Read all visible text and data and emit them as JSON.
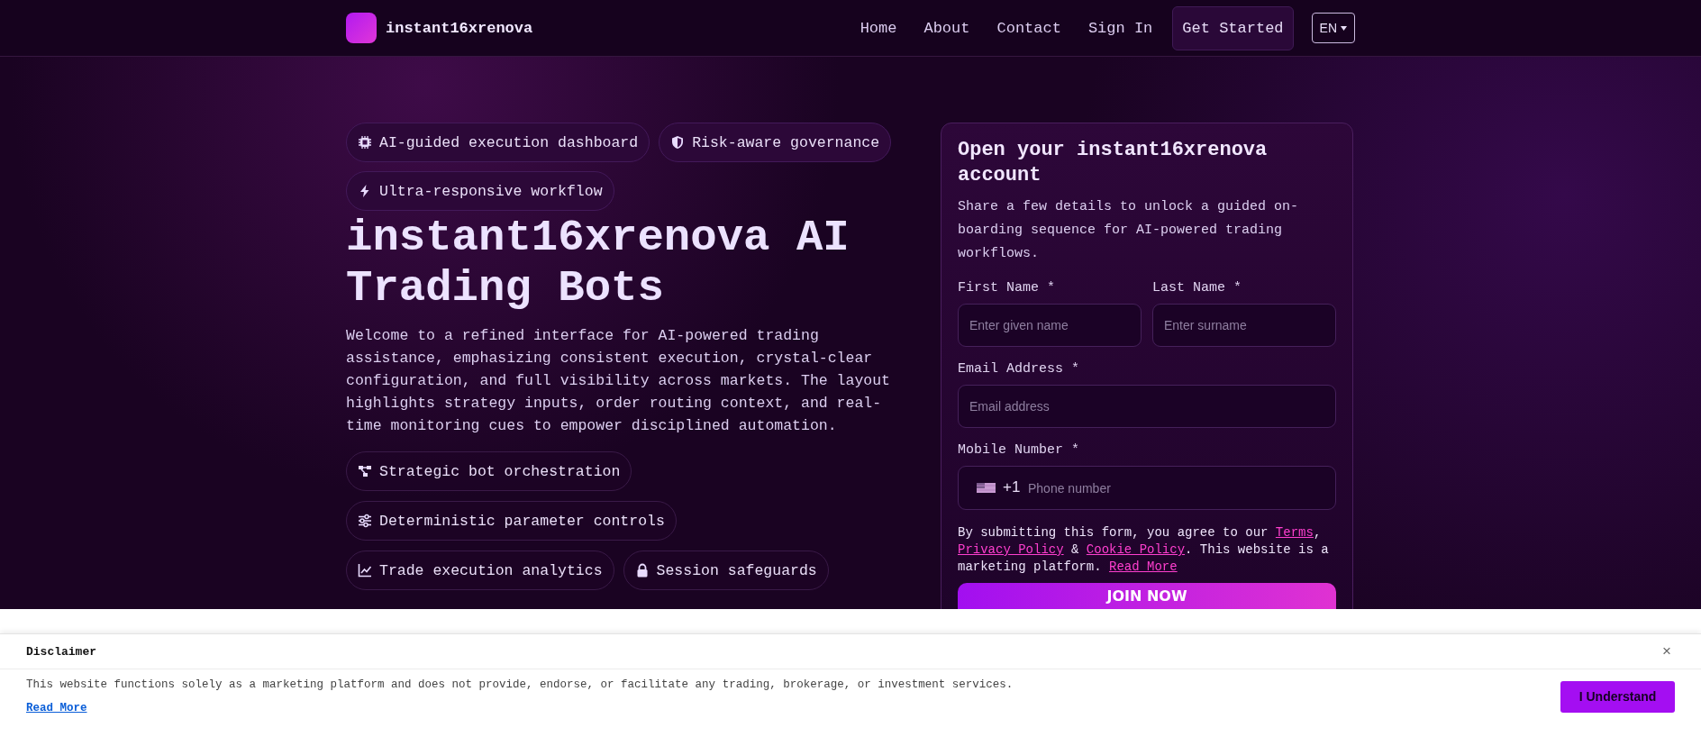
{
  "header": {
    "brand": "instant16xrenova",
    "nav": [
      {
        "label": "Home"
      },
      {
        "label": "About"
      },
      {
        "label": "Contact"
      },
      {
        "label": "Sign In"
      }
    ],
    "cta": "Get Started",
    "language": "EN"
  },
  "hero": {
    "badges": [
      {
        "label": "AI-guided execution dashboard"
      },
      {
        "label": "Risk-aware governance"
      },
      {
        "label": "Ultra-responsive workflow"
      }
    ],
    "title": "instant16xrenova AI Trading Bots",
    "description": "Welcome to a refined interface for AI-powered trading assistance, emphasizing consistent execution, crystal-clear configuration, and full visibility across markets. The layout highlights strategy inputs, order routing context, and real-time monitoring cues to empower disciplined automation.",
    "features": [
      {
        "label": "Strategic bot orchestration"
      },
      {
        "label": "Deterministic parameter controls"
      },
      {
        "label": "Trade execution analytics"
      },
      {
        "label": "Session safeguards"
      }
    ]
  },
  "form": {
    "title": "Open your instant16xrenova account",
    "description": "Share a few details to unlock a guided on-boarding sequence for AI-powered trading workflows.",
    "name_fields": [
      {
        "label": "First Name *",
        "placeholder": "Enter given name"
      },
      {
        "label": "Last Name *",
        "placeholder": "Enter surname"
      }
    ],
    "email": {
      "label": "Email Address *",
      "placeholder": "Email address"
    },
    "phone": {
      "label": "Mobile Number *",
      "country_code": "+1",
      "placeholder": "Phone number"
    },
    "consent": [
      {
        "text": "By submitting this form, you agree to our ",
        "kind": "text"
      },
      {
        "text": "Terms",
        "kind": "link"
      },
      {
        "text": ", ",
        "kind": "text"
      },
      {
        "text": "Privacy Policy",
        "kind": "link"
      },
      {
        "text": " & ",
        "kind": "text"
      },
      {
        "text": "Cookie Policy",
        "kind": "link"
      },
      {
        "text": ". This website is a marketing platform. ",
        "kind": "text"
      },
      {
        "text": "Read More",
        "kind": "link"
      }
    ],
    "submit": "JOIN NOW"
  },
  "disclaimer": {
    "title": "Disclaimer",
    "close": "×",
    "text": "This website functions solely as a marketing platform and does not provide, endorse, or facilitate any trading, brokerage, or investment services.",
    "link": "Read More",
    "button": "I Understand"
  }
}
